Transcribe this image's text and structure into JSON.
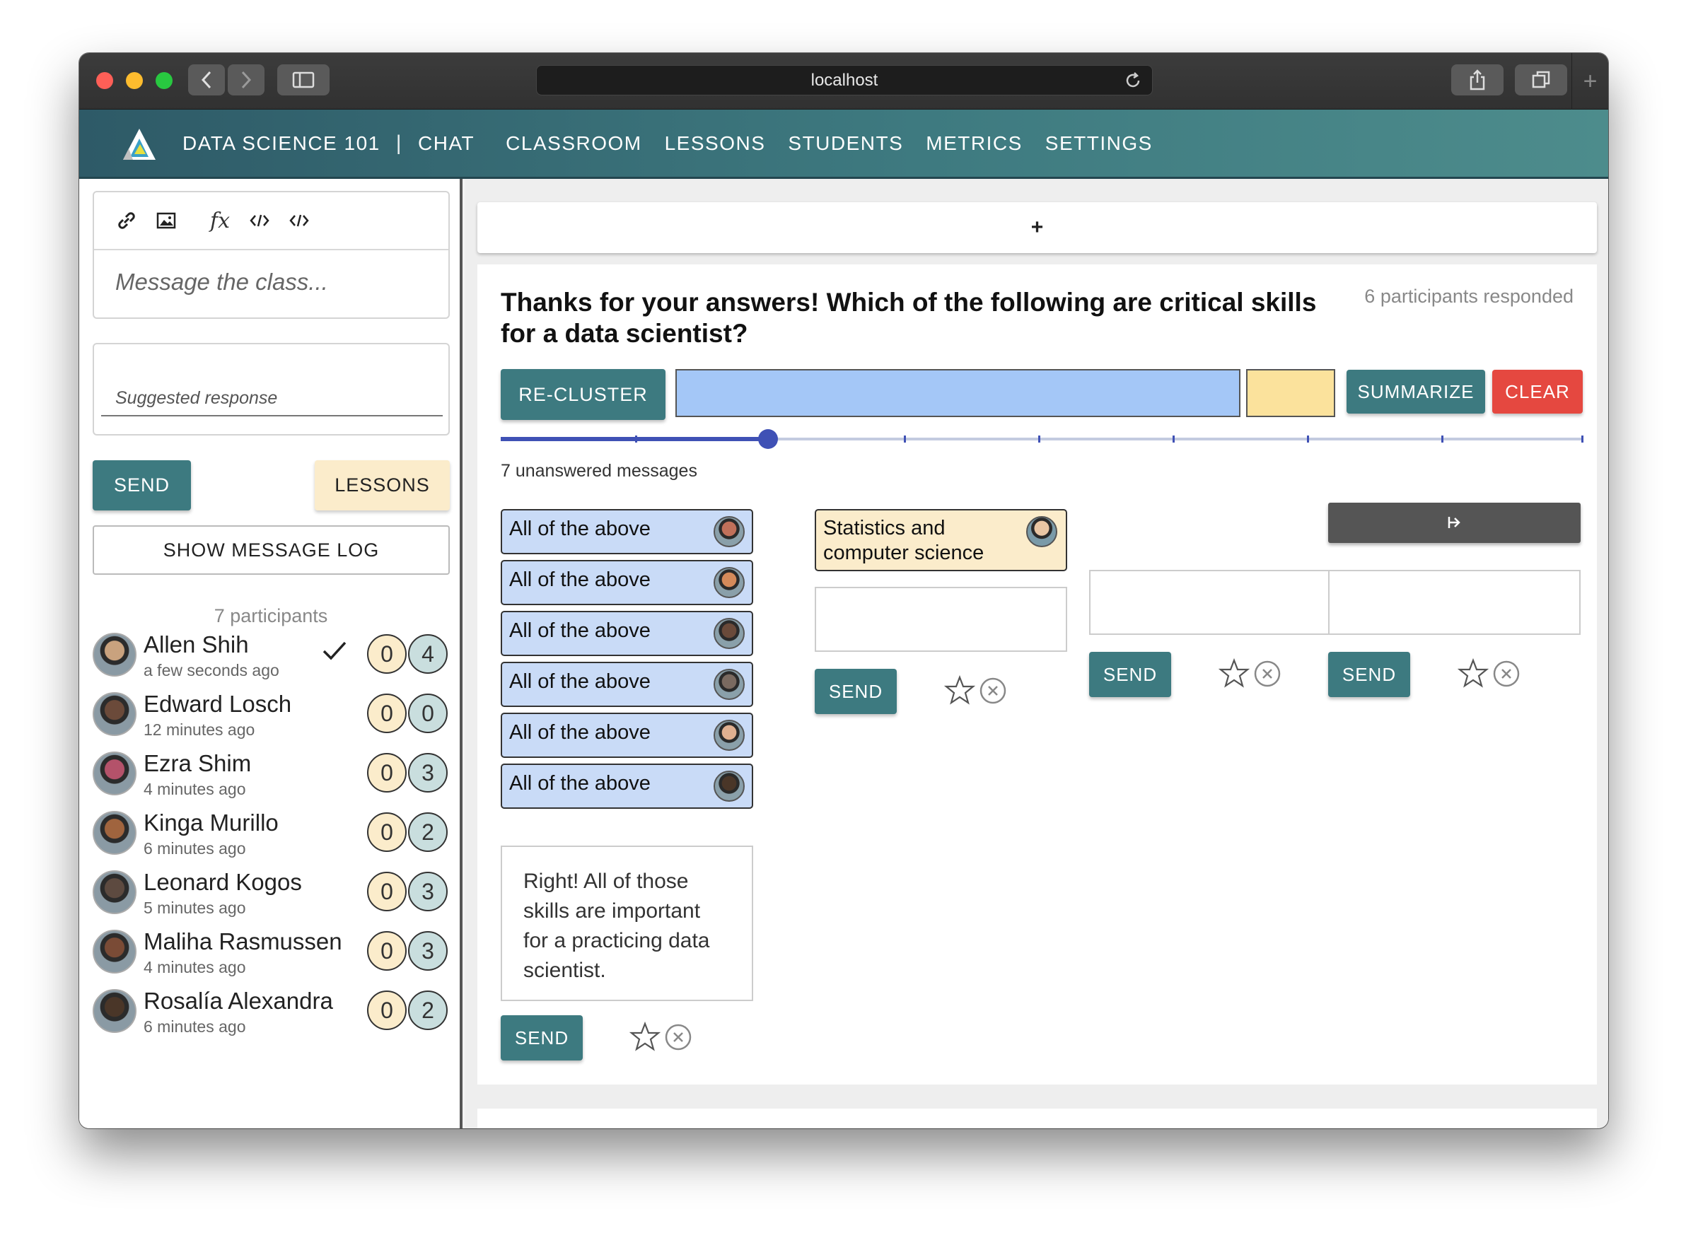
{
  "browser": {
    "url": "localhost"
  },
  "nav": {
    "course": "DATA SCIENCE 101",
    "separator": "|",
    "items": [
      "CHAT",
      "CLASSROOM",
      "LESSONS",
      "STUDENTS",
      "METRICS",
      "SETTINGS"
    ]
  },
  "sidebar": {
    "message_placeholder": "Message the class...",
    "suggested_placeholder": "Suggested response",
    "send_label": "SEND",
    "lessons_label": "LESSONS",
    "log_label": "SHOW MESSAGE LOG",
    "participants_count": "7 participants",
    "participants": [
      {
        "name": "Allen Shih",
        "time": "a few seconds ago",
        "answered": "0",
        "messages": "4",
        "checked": true,
        "color": "#c9a27e"
      },
      {
        "name": "Edward Losch",
        "time": "12 minutes ago",
        "answered": "0",
        "messages": "0",
        "checked": false,
        "color": "#6b4a3a"
      },
      {
        "name": "Ezra Shim",
        "time": "4 minutes ago",
        "answered": "0",
        "messages": "3",
        "checked": false,
        "color": "#b4526a"
      },
      {
        "name": "Kinga Murillo",
        "time": "6 minutes ago",
        "answered": "0",
        "messages": "2",
        "checked": false,
        "color": "#a0643e"
      },
      {
        "name": "Leonard Kogos",
        "time": "5 minutes ago",
        "answered": "0",
        "messages": "3",
        "checked": false,
        "color": "#5d4a40"
      },
      {
        "name": "Maliha Rasmussen",
        "time": "4 minutes ago",
        "answered": "0",
        "messages": "3",
        "checked": false,
        "color": "#7a4b36"
      },
      {
        "name": "Rosalía Alexandra",
        "time": "6 minutes ago",
        "answered": "0",
        "messages": "2",
        "checked": false,
        "color": "#4a3628"
      }
    ]
  },
  "main": {
    "add_label": "+",
    "question": "Thanks for your answers! Which of the following are critical skills for a data scientist?",
    "responded": "6 participants responded",
    "recluster_label": "RE-CLUSTER",
    "summarize_label": "SUMMARIZE",
    "clear_label": "CLEAR",
    "cluster_level": 3,
    "unanswered": "7 unanswered messages",
    "cluster1": {
      "responses": [
        "All of the above",
        "All of the above",
        "All of the above",
        "All of the above",
        "All of the above",
        "All of the above"
      ],
      "reply": "Right! All of those skills are important for a practicing data scientist.",
      "send_label": "SEND"
    },
    "cluster2": {
      "response": "Statistics and computer science",
      "send_label": "SEND"
    },
    "cluster3": {
      "send_label": "SEND"
    },
    "cluster4": {
      "send_label": "SEND"
    }
  },
  "colors": {
    "teal": "#3d7a80",
    "clear_red": "#e54840",
    "response_blue": "#c9dbf7",
    "response_yellow": "#fbeccb"
  }
}
